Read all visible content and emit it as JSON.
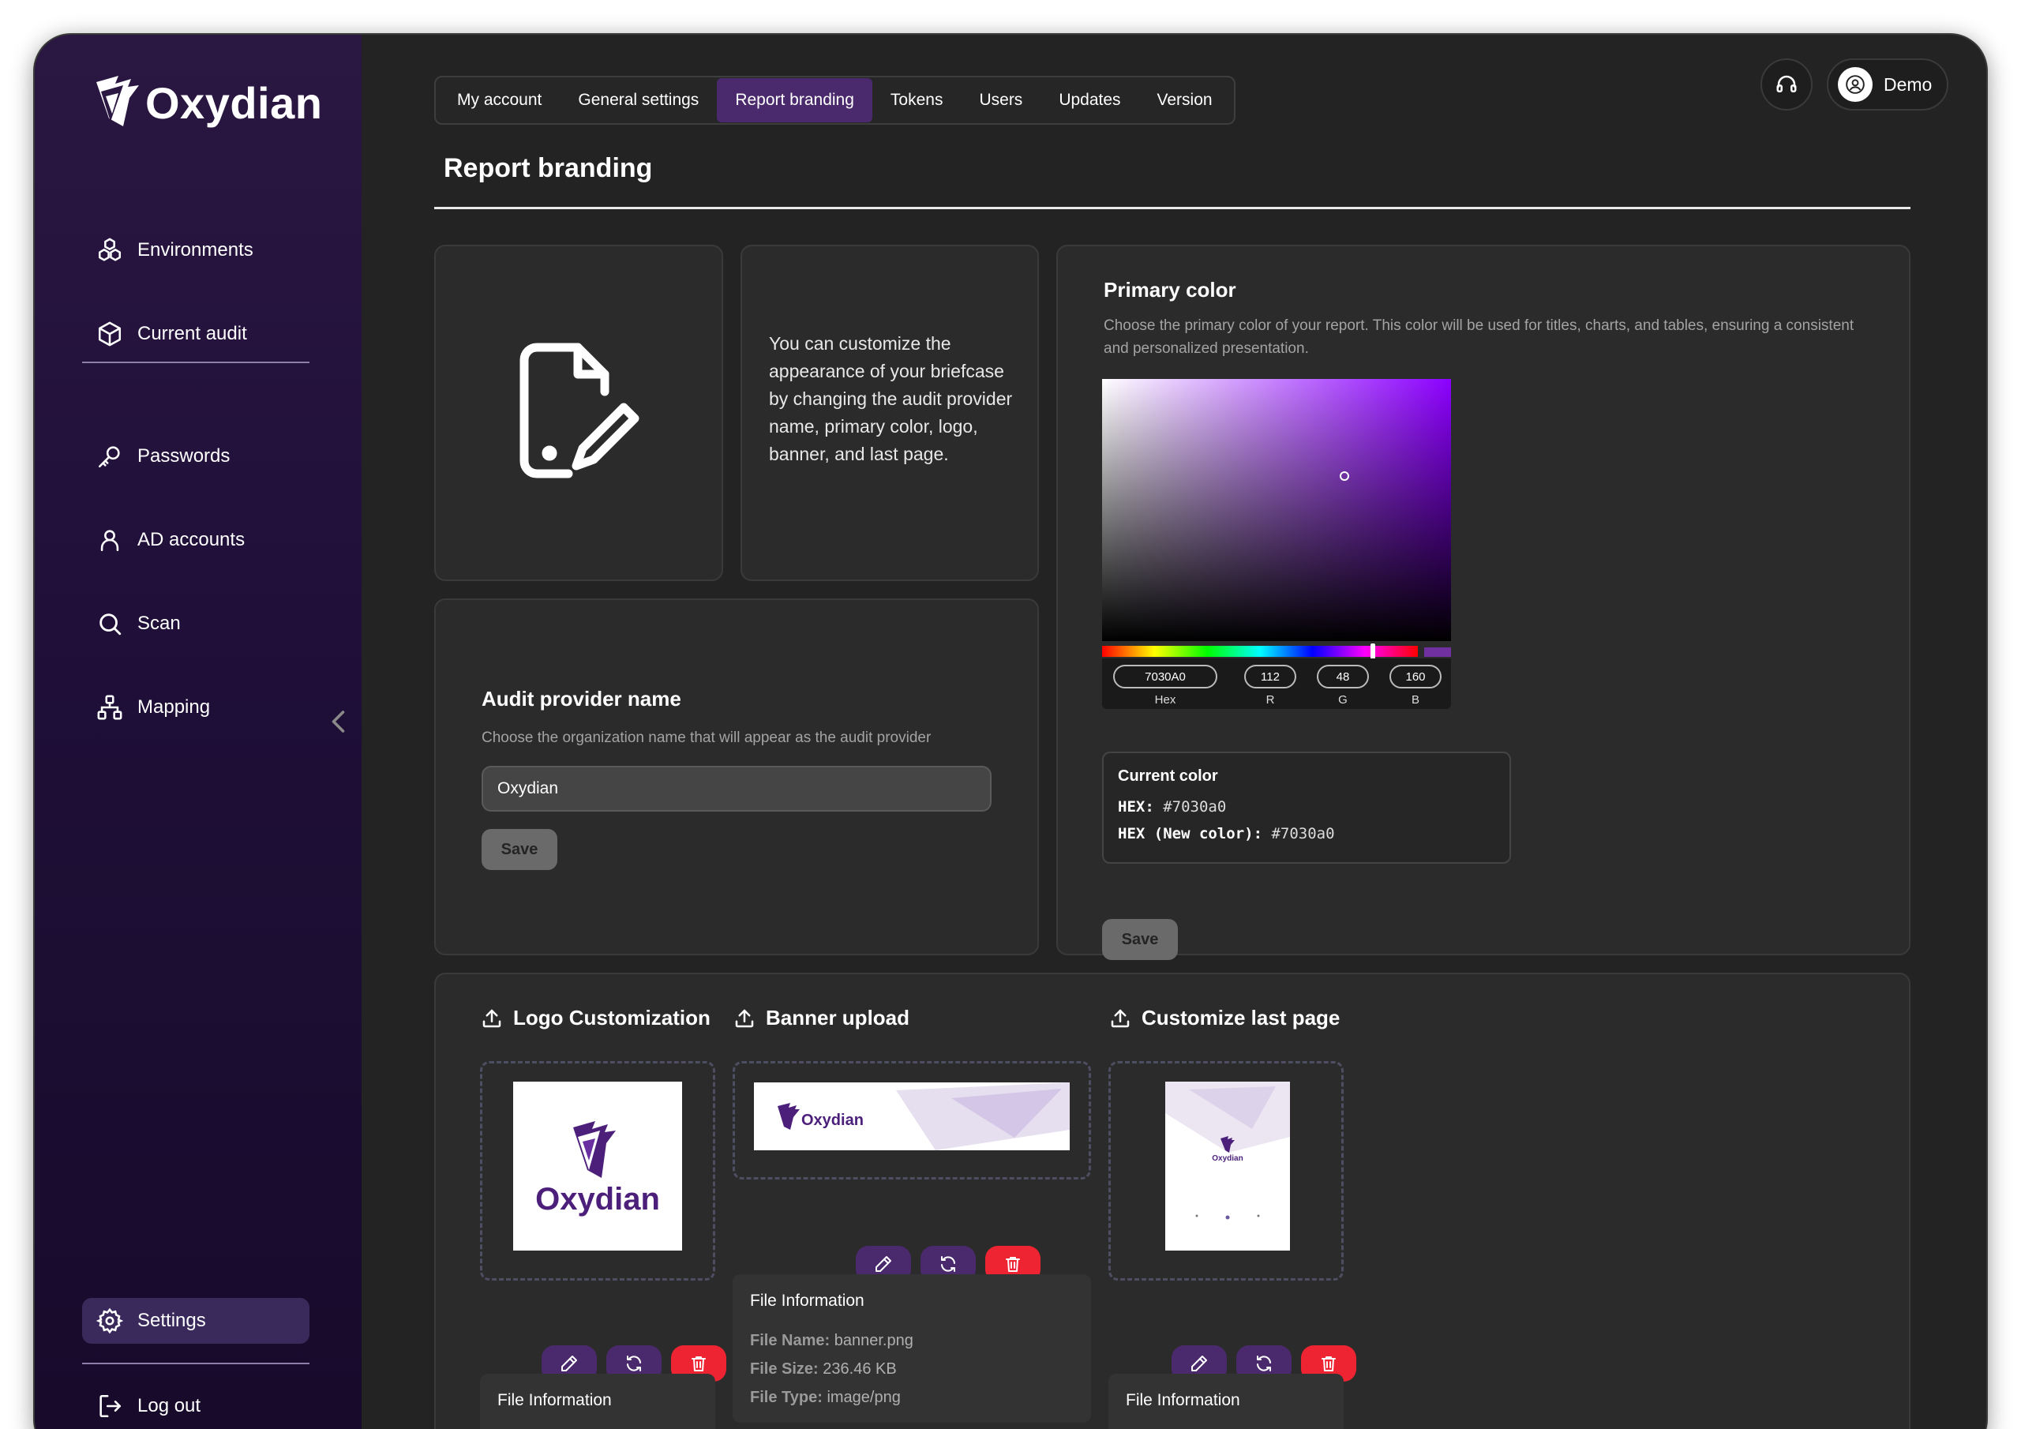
{
  "app": {
    "name": "Oxydian"
  },
  "sidebar": {
    "items": [
      {
        "label": "Environments",
        "icon": "environments-icon"
      },
      {
        "label": "Current audit",
        "icon": "cube-icon"
      },
      {
        "label": "Passwords",
        "icon": "key-icon"
      },
      {
        "label": "AD accounts",
        "icon": "user-icon"
      },
      {
        "label": "Scan",
        "icon": "search-icon"
      },
      {
        "label": "Mapping",
        "icon": "sitemap-icon"
      }
    ],
    "settings_label": "Settings",
    "logout_label": "Log out"
  },
  "tabs": [
    "My account",
    "General settings",
    "Report branding",
    "Tokens",
    "Users",
    "Updates",
    "Version"
  ],
  "active_tab": "Report branding",
  "header": {
    "user_name": "Demo"
  },
  "page": {
    "title": "Report branding",
    "intro_text": "You can customize the appearance of your briefcase by changing the audit provider name, primary color, logo, banner, and last page."
  },
  "provider": {
    "title": "Audit provider name",
    "description": "Choose the organization name that will appear as the audit provider",
    "value": "Oxydian",
    "save_label": "Save"
  },
  "primary_color": {
    "title": "Primary color",
    "description": "Choose the primary color of your report. This color will be used for titles, charts, and tables, ensuring a consistent and personalized presentation.",
    "hex": "7030A0",
    "r": "112",
    "g": "48",
    "b": "160",
    "hex_label": "Hex",
    "r_label": "R",
    "g_label": "G",
    "b_label": "B",
    "current_title": "Current color",
    "current_hex_label": "HEX:",
    "current_hex_value": "#7030a0",
    "new_hex_label": "HEX (New color):",
    "new_hex_value": "#7030a0",
    "save_label": "Save",
    "accent": "#7030a0"
  },
  "uploads": {
    "logo": {
      "title": "Logo Customization",
      "info_title": "File Information"
    },
    "banner": {
      "title": "Banner upload",
      "info_title": "File Information",
      "file_name_label": "File Name:",
      "file_name": "banner.png",
      "file_size_label": "File Size:",
      "file_size": "236.46 KB",
      "file_type_label": "File Type:",
      "file_type": "image/png"
    },
    "last_page": {
      "title": "Customize last page",
      "info_title": "File Information"
    }
  },
  "colors": {
    "sidebar": "#22123a",
    "active_tab": "#4a2a6c",
    "delete": "#ee2433",
    "edit": "#4a2a6c"
  }
}
